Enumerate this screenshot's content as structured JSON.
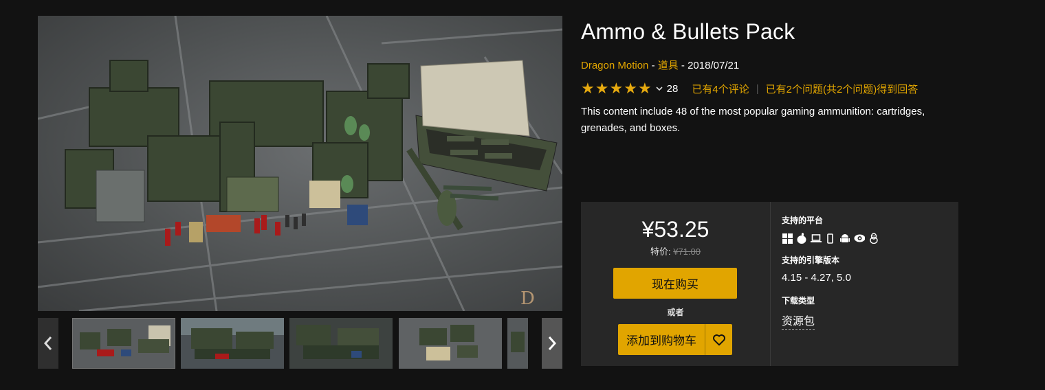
{
  "product": {
    "title": "Ammo & Bullets Pack",
    "seller": "Dragon Motion",
    "sep1": "-",
    "category": "道具",
    "sep2": "-",
    "date": "2018/07/21",
    "rating_value": 5,
    "rating_count": "28",
    "reviews_link": "已有4个评论",
    "rating_separator": "|",
    "questions_link": "已有2个问题(共2个问题)得到回答",
    "description": "This content include 48 of the most popular gaming ammunition: cartridges, grenades, and boxes."
  },
  "gallery": {
    "thumbnails": [
      "thumbnail-1",
      "thumbnail-2",
      "thumbnail-3",
      "thumbnail-4",
      "thumbnail-5"
    ],
    "selected_index": 0
  },
  "purchase": {
    "price": "¥53.25",
    "sale_label": "特价:",
    "original_price": "¥71.00",
    "buy_now": "现在购买",
    "or_text": "或者",
    "add_to_cart": "添加到购物车"
  },
  "specs": {
    "platforms_label": "支持的平台",
    "platform_icons": [
      "windows-icon",
      "apple-icon",
      "laptop-icon",
      "phone-icon",
      "android-icon",
      "vr-eye-icon",
      "linux-icon"
    ],
    "engine_label": "支持的引擎版本",
    "engine_versions": "4.15 - 4.27, 5.0",
    "download_label": "下载类型",
    "download_type": "资源包"
  },
  "colors": {
    "background": "#121212",
    "panel": "#272727",
    "accent": "#e1a500",
    "star": "#e7aa0f"
  }
}
